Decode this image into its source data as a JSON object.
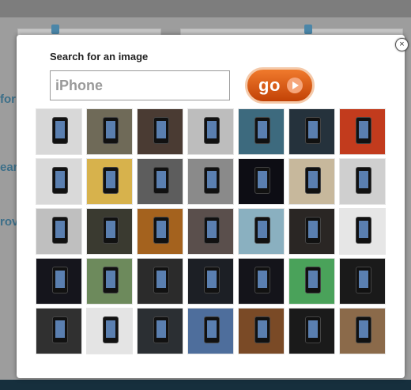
{
  "dialog": {
    "title": "Search for an image",
    "close_symbol": "×",
    "search_value": "iPhone",
    "go_label": "go"
  },
  "background": {
    "side_text_1": "for",
    "side_text_2": "ear",
    "side_text_3": "rov"
  },
  "thumbnails": [
    {
      "bg": "#d8d8d8"
    },
    {
      "bg": "#6f6a58"
    },
    {
      "bg": "#4a3b33"
    },
    {
      "bg": "#bdbdbd"
    },
    {
      "bg": "#3d6a7e"
    },
    {
      "bg": "#25323c"
    },
    {
      "bg": "#c23b1d"
    },
    {
      "bg": "#d9d9d9"
    },
    {
      "bg": "#d7b24c"
    },
    {
      "bg": "#5d5d5d"
    },
    {
      "bg": "#8a8a8a"
    },
    {
      "bg": "#0d0d14"
    },
    {
      "bg": "#c7b89c"
    },
    {
      "bg": "#cfcfcf"
    },
    {
      "bg": "#bfbfbf"
    },
    {
      "bg": "#3a3a30"
    },
    {
      "bg": "#a4621e"
    },
    {
      "bg": "#5a4f4c"
    },
    {
      "bg": "#8ab0c0"
    },
    {
      "bg": "#2a2624"
    },
    {
      "bg": "#e6e6e6"
    },
    {
      "bg": "#15151c"
    },
    {
      "bg": "#6d8a5c"
    },
    {
      "bg": "#2b2b2b"
    },
    {
      "bg": "#1c1f25"
    },
    {
      "bg": "#14141a"
    },
    {
      "bg": "#4aa25a"
    },
    {
      "bg": "#1a1a1a"
    },
    {
      "bg": "#303030"
    },
    {
      "bg": "#e4e4e4"
    },
    {
      "bg": "#2b2f33"
    },
    {
      "bg": "#4e6e9c"
    },
    {
      "bg": "#7a4a26"
    },
    {
      "bg": "#1a1a1a"
    },
    {
      "bg": "#8b6a4a"
    }
  ]
}
